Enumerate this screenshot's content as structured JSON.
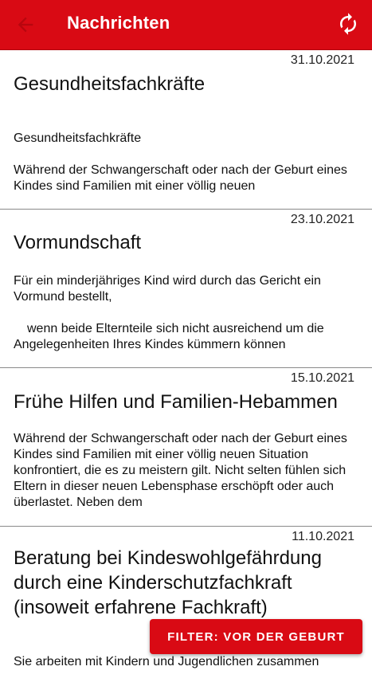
{
  "appbar": {
    "title": "Nachrichten",
    "back_icon": "arrow-left-icon",
    "refresh_icon": "refresh-icon",
    "color": "#d90a14"
  },
  "messages": [
    {
      "date": "31.10.2021",
      "title": "Gesundheitsfachkräfte",
      "body": [
        "Gesundheitsfachkräfte",
        "",
        "Während der Schwangerschaft oder nach der Geburt eines Kindes sind Familien mit einer völlig neuen"
      ]
    },
    {
      "date": "23.10.2021",
      "title": "Vormundschaft",
      "body": [
        "Für ein minderjähriges Kind wird durch das Gericht ein Vormund bestellt,",
        "",
        "wenn beide Elternteile sich nicht ausreichend um die Angelegenheiten Ihres Kindes kümmern können"
      ]
    },
    {
      "date": "15.10.2021",
      "title": "Frühe Hilfen und Familien-Hebammen",
      "body": [
        "Während der Schwangerschaft oder nach der Geburt eines Kindes sind Familien mit einer völlig neuen Situation konfrontiert, die es zu meistern gilt. Nicht selten fühlen sich Eltern in dieser neuen Lebensphase erschöpft oder auch überlastet. Neben dem"
      ]
    },
    {
      "date": "11.10.2021",
      "title": "Beratung bei Kindeswohlgefährdung durch eine Kinderschutzfachkraft (insoweit erfahrene Fachkraft)",
      "title_lines": [
        "Beratung bei Kindeswohlgefährdung",
        "durch eine Kinderschutzfachkraft",
        "(insoweit erfahrene Fachkraft)"
      ],
      "body": [
        "Sie arbeiten mit Kindern und Jugendlichen zusammen"
      ]
    }
  ],
  "filter_button": {
    "label": "FILTER: VOR DER GEBURT"
  }
}
